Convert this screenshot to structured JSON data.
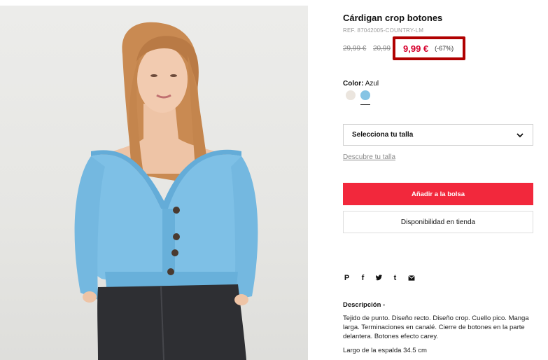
{
  "product": {
    "title": "Cárdigan crop botones",
    "ref": "REF. 87042005-COUNTRY-LM",
    "old_price_1": "29,99 €",
    "old_price_2": "20,99",
    "current_price": "9,99 €",
    "discount": "(-67%)",
    "highlight_color": "#b00000",
    "price_color": "#d6002d"
  },
  "color": {
    "label": "Color:",
    "selected": "Azul",
    "swatches": [
      {
        "name": "beige",
        "hex": "#ebe5de"
      },
      {
        "name": "azul",
        "hex": "#86c4e4",
        "selected": true
      }
    ]
  },
  "size": {
    "select_label": "Selecciona tu talla",
    "guide_link": "Descubre tu talla"
  },
  "actions": {
    "add_to_bag": "Añadir a la bolsa",
    "add_color": "#f2283c",
    "store_availability": "Disponibilidad en tienda"
  },
  "share": {
    "icons": [
      "pinterest-icon",
      "facebook-icon",
      "twitter-icon",
      "tumblr-icon",
      "email-icon"
    ],
    "pinterest": "P",
    "facebook": "f",
    "tumblr": "t"
  },
  "description": {
    "title": "Descripción -",
    "body": "Tejido de punto. Diseño recto. Diseño crop. Cuello pico. Manga larga. Terminaciones en canalé. Cierre de botones en la parte delantera. Botones efecto carey.",
    "length": "Largo de la espalda 34.5 cm"
  }
}
